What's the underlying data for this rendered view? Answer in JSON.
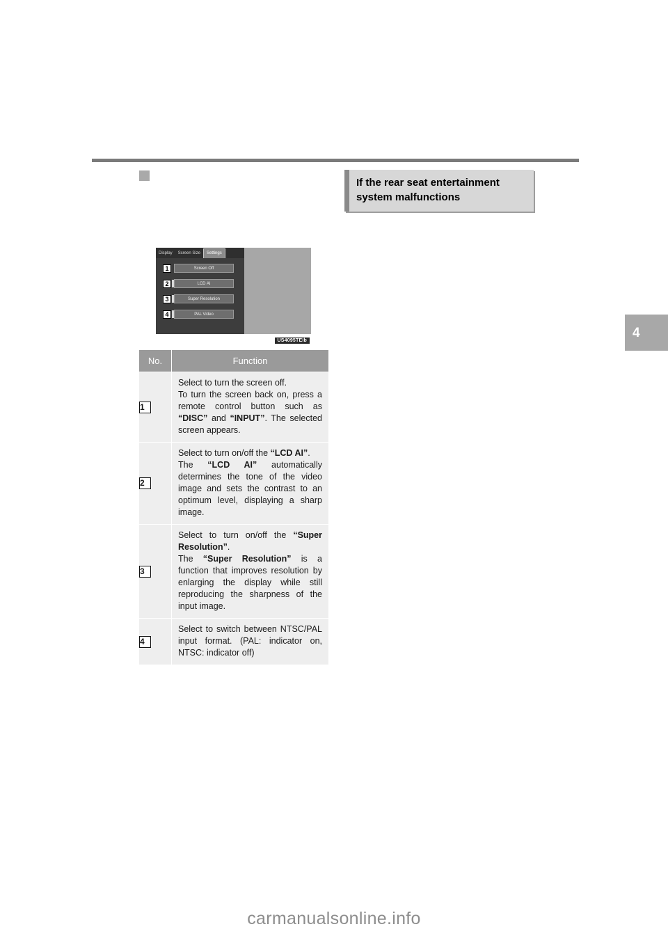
{
  "page": {
    "chapter_tab_number": "4",
    "watermark": "carmanualsonline.info"
  },
  "section_heading": {
    "line1": "If the rear seat entertainment",
    "line2": "system malfunctions"
  },
  "device_screenshot": {
    "caption": "US4095TEIb",
    "tabs": [
      {
        "label": "Display",
        "selected": false
      },
      {
        "label": "Screen Size",
        "selected": false
      },
      {
        "label": "Settings",
        "selected": true
      }
    ],
    "buttons": [
      {
        "callout": "1",
        "label": "Screen Off",
        "indicator": false
      },
      {
        "callout": "2",
        "label": "LCD AI",
        "indicator": true
      },
      {
        "callout": "3",
        "label": "Super Resolution",
        "indicator": true
      },
      {
        "callout": "4",
        "label": "PAL Video",
        "indicator": true
      }
    ]
  },
  "function_table": {
    "headers": {
      "no": "No.",
      "function": "Function"
    },
    "rows": [
      {
        "no": "1",
        "text_parts": [
          {
            "t": "Select to turn the screen off.\nTo turn the screen back on, press a remote control button such as ",
            "b": false
          },
          {
            "t": "“DISC”",
            "b": true
          },
          {
            "t": " and ",
            "b": false
          },
          {
            "t": "“INPUT”",
            "b": true
          },
          {
            "t": ". The selected screen appears.",
            "b": false
          }
        ]
      },
      {
        "no": "2",
        "text_parts": [
          {
            "t": "Select to turn on/off the ",
            "b": false
          },
          {
            "t": "“LCD AI”",
            "b": true
          },
          {
            "t": ".\nThe ",
            "b": false
          },
          {
            "t": "“LCD AI”",
            "b": true
          },
          {
            "t": " automatically determines the tone of the video image and sets the contrast to an optimum level, displaying a sharp image.",
            "b": false
          }
        ]
      },
      {
        "no": "3",
        "text_parts": [
          {
            "t": "Select to turn on/off the ",
            "b": false
          },
          {
            "t": "“Super Resolution”",
            "b": true
          },
          {
            "t": ".\nThe ",
            "b": false
          },
          {
            "t": "“Super Resolution”",
            "b": true
          },
          {
            "t": " is a function that improves resolution by enlarging the display while still reproducing the sharpness of the input image.",
            "b": false
          }
        ]
      },
      {
        "no": "4",
        "text_parts": [
          {
            "t": "Select to switch between NTSC/PAL input format. (PAL: indicator on, NTSC: indicator off)",
            "b": false
          }
        ]
      }
    ]
  }
}
